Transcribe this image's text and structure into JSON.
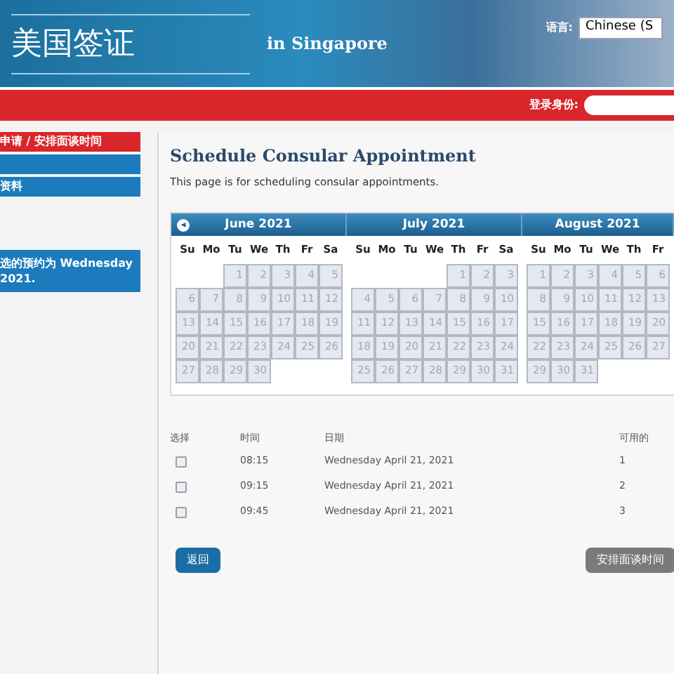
{
  "header": {
    "title": "美国签证",
    "subtitle": "in Singapore",
    "language_label": "语言:",
    "language_value": "Chinese (S"
  },
  "account_bar": {
    "label": "登录身份:"
  },
  "sidebar": {
    "items": [
      {
        "label": "申请 / 安排面谈时间",
        "selected": true
      },
      {
        "selected": false
      },
      {
        "label": "资料",
        "selected": false
      }
    ],
    "notice": "选的预约为 Wednesday 2021."
  },
  "page": {
    "title": "Schedule Consular Appointment",
    "description": "This page is for scheduling consular appointments."
  },
  "calendar": {
    "prev_button": "◂",
    "months": [
      {
        "title": "June 2021",
        "weekdays": [
          "Su",
          "Mo",
          "Tu",
          "We",
          "Th",
          "Fr",
          "Sa"
        ],
        "weeks": [
          [
            {
              "kind": "blank"
            },
            {
              "kind": "blank"
            },
            {
              "kind": "day",
              "label": "1"
            },
            {
              "kind": "day",
              "label": "2"
            },
            {
              "kind": "day",
              "label": "3"
            },
            {
              "kind": "day",
              "label": "4"
            },
            {
              "kind": "day",
              "label": "5"
            }
          ],
          [
            {
              "kind": "day",
              "label": "6"
            },
            {
              "kind": "day",
              "label": "7"
            },
            {
              "kind": "day",
              "label": "8"
            },
            {
              "kind": "day",
              "label": "9"
            },
            {
              "kind": "day",
              "label": "10"
            },
            {
              "kind": "day",
              "label": "11"
            },
            {
              "kind": "day",
              "label": "12"
            }
          ],
          [
            {
              "kind": "day",
              "label": "13"
            },
            {
              "kind": "day",
              "label": "14"
            },
            {
              "kind": "day",
              "label": "15"
            },
            {
              "kind": "day",
              "label": "16"
            },
            {
              "kind": "day",
              "label": "17"
            },
            {
              "kind": "day",
              "label": "18"
            },
            {
              "kind": "day",
              "label": "19"
            }
          ],
          [
            {
              "kind": "day",
              "label": "20"
            },
            {
              "kind": "day",
              "label": "21"
            },
            {
              "kind": "day",
              "label": "22"
            },
            {
              "kind": "day",
              "label": "23"
            },
            {
              "kind": "day",
              "label": "24"
            },
            {
              "kind": "day",
              "label": "25"
            },
            {
              "kind": "day",
              "label": "26"
            }
          ],
          [
            {
              "kind": "day",
              "label": "27"
            },
            {
              "kind": "day",
              "label": "28"
            },
            {
              "kind": "day",
              "label": "29"
            },
            {
              "kind": "day",
              "label": "30"
            }
          ]
        ]
      },
      {
        "title": "July 2021",
        "weekdays": [
          "Su",
          "Mo",
          "Tu",
          "We",
          "Th",
          "Fr",
          "Sa"
        ],
        "weeks": [
          [
            {
              "kind": "blank"
            },
            {
              "kind": "blank"
            },
            {
              "kind": "blank"
            },
            {
              "kind": "blank"
            },
            {
              "kind": "day",
              "label": "1"
            },
            {
              "kind": "day",
              "label": "2"
            },
            {
              "kind": "day",
              "label": "3"
            }
          ],
          [
            {
              "kind": "day",
              "label": "4"
            },
            {
              "kind": "day",
              "label": "5"
            },
            {
              "kind": "day",
              "label": "6"
            },
            {
              "kind": "day",
              "label": "7"
            },
            {
              "kind": "day",
              "label": "8"
            },
            {
              "kind": "day",
              "label": "9"
            },
            {
              "kind": "day",
              "label": "10"
            }
          ],
          [
            {
              "kind": "day",
              "label": "11"
            },
            {
              "kind": "day",
              "label": "12"
            },
            {
              "kind": "day",
              "label": "13"
            },
            {
              "kind": "day",
              "label": "14"
            },
            {
              "kind": "day",
              "label": "15"
            },
            {
              "kind": "day",
              "label": "16"
            },
            {
              "kind": "day",
              "label": "17"
            }
          ],
          [
            {
              "kind": "day",
              "label": "18"
            },
            {
              "kind": "day",
              "label": "19"
            },
            {
              "kind": "day",
              "label": "20"
            },
            {
              "kind": "day",
              "label": "21"
            },
            {
              "kind": "day",
              "label": "22"
            },
            {
              "kind": "day",
              "label": "23"
            },
            {
              "kind": "day",
              "label": "24"
            }
          ],
          [
            {
              "kind": "day",
              "label": "25"
            },
            {
              "kind": "day",
              "label": "26"
            },
            {
              "kind": "day",
              "label": "27"
            },
            {
              "kind": "day",
              "label": "28"
            },
            {
              "kind": "day",
              "label": "29"
            },
            {
              "kind": "day",
              "label": "30"
            },
            {
              "kind": "day",
              "label": "31"
            }
          ]
        ]
      },
      {
        "title": "August 2021",
        "weekdays": [
          "Su",
          "Mo",
          "Tu",
          "We",
          "Th",
          "Fr"
        ],
        "weeks": [
          [
            {
              "kind": "day",
              "label": "1"
            },
            {
              "kind": "day",
              "label": "2"
            },
            {
              "kind": "day",
              "label": "3"
            },
            {
              "kind": "day",
              "label": "4"
            },
            {
              "kind": "day",
              "label": "5"
            },
            {
              "kind": "day",
              "label": "6"
            }
          ],
          [
            {
              "kind": "day",
              "label": "8"
            },
            {
              "kind": "day",
              "label": "9"
            },
            {
              "kind": "day",
              "label": "10"
            },
            {
              "kind": "day",
              "label": "11"
            },
            {
              "kind": "day",
              "label": "12"
            },
            {
              "kind": "day",
              "label": "13"
            }
          ],
          [
            {
              "kind": "day",
              "label": "15"
            },
            {
              "kind": "day",
              "label": "16"
            },
            {
              "kind": "day",
              "label": "17"
            },
            {
              "kind": "day",
              "label": "18"
            },
            {
              "kind": "day",
              "label": "19"
            },
            {
              "kind": "day",
              "label": "20"
            }
          ],
          [
            {
              "kind": "day",
              "label": "22"
            },
            {
              "kind": "day",
              "label": "23"
            },
            {
              "kind": "day",
              "label": "24"
            },
            {
              "kind": "day",
              "label": "25"
            },
            {
              "kind": "day",
              "label": "26"
            },
            {
              "kind": "day",
              "label": "27"
            }
          ],
          [
            {
              "kind": "day",
              "label": "29"
            },
            {
              "kind": "day",
              "label": "30"
            },
            {
              "kind": "day",
              "label": "31"
            }
          ]
        ]
      }
    ]
  },
  "slots": {
    "columns": [
      "选择",
      "时间",
      "日期",
      "可用的"
    ],
    "rows": [
      {
        "checked": false,
        "time": "08:15",
        "date": "Wednesday April 21, 2021",
        "available": "1"
      },
      {
        "checked": false,
        "time": "09:15",
        "date": "Wednesday April 21, 2021",
        "available": "2"
      },
      {
        "checked": false,
        "time": "09:45",
        "date": "Wednesday April 21, 2021",
        "available": "3"
      }
    ]
  },
  "buttons": {
    "back": "返回",
    "schedule": "安排面谈时间"
  }
}
